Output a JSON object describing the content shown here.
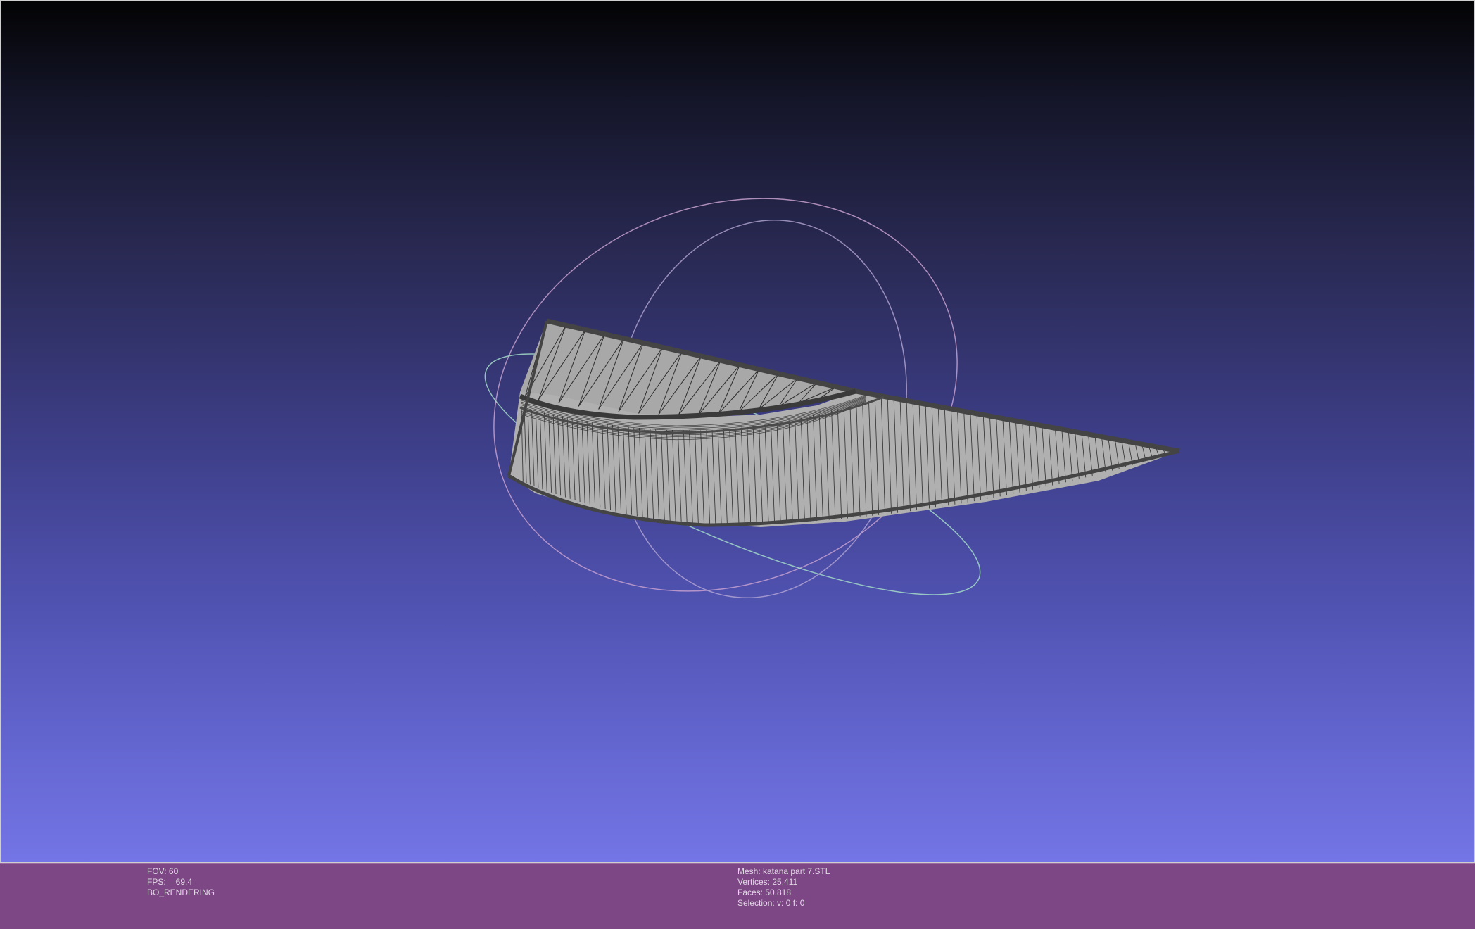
{
  "viewer": {
    "mesh_label": "Mesh: katana part 7.STL",
    "vertices_label": "Vertices: 25,411",
    "faces_label": "Faces: 50,818",
    "selection_label": "Selection: v: 0 f: 0",
    "fov_label": "FOV: 60",
    "fps_prefix": "FPS:",
    "fps_value": "69.4",
    "render_mode": "BO_RENDERING"
  },
  "colors": {
    "background_top": "#030304",
    "background_bottom": "#7475e6",
    "status_bar": "#7d4785",
    "mesh_face": "#a9a9a9",
    "mesh_edge": "#3a3a3a",
    "trackball_x": "#c9a0c0",
    "trackball_y": "#9fd6c2",
    "trackball_z": "#a7a0d8"
  },
  "icons": {
    "trackball": "trackball-gizmo",
    "mesh": "wireframe-mesh"
  }
}
